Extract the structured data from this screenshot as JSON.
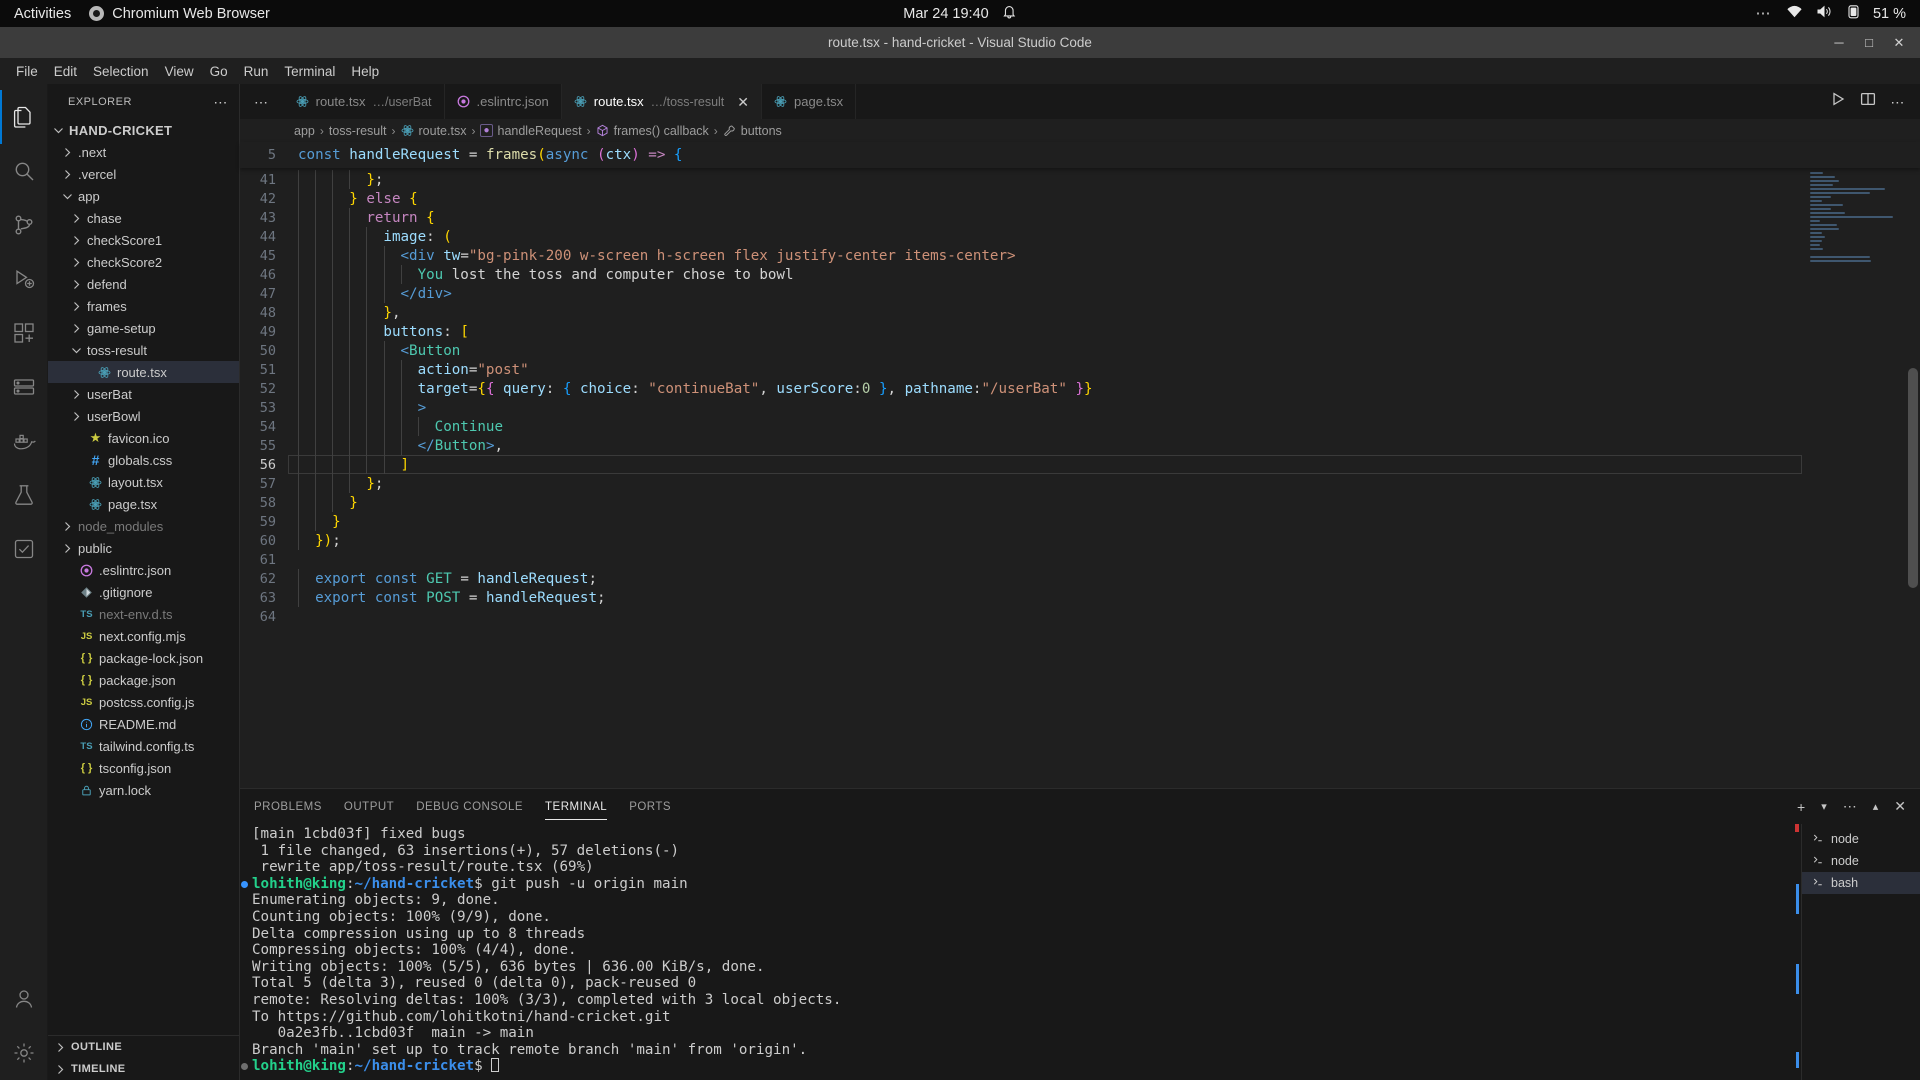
{
  "desktop": {
    "activities": "Activities",
    "active_app": "Chromium Web Browser",
    "app_icon": "chromium-icon",
    "clock": "Mar 24  19:40",
    "bell_icon": "notification-bell-icon",
    "tray_dots": "⋯",
    "wifi_icon": "wifi-icon",
    "volume_icon": "volume-icon",
    "battery_icon": "battery-icon",
    "battery_pct": "51 %"
  },
  "window": {
    "title": "route.tsx - hand-cricket - Visual Studio Code",
    "minimize": "─",
    "maximize": "□",
    "close": "✕"
  },
  "menubar": [
    "File",
    "Edit",
    "Selection",
    "View",
    "Go",
    "Run",
    "Terminal",
    "Help"
  ],
  "activitybar": [
    {
      "name": "explorer",
      "icon": "files-icon",
      "active": true
    },
    {
      "name": "search",
      "icon": "search-icon",
      "active": false
    },
    {
      "name": "source-control",
      "icon": "source-control-icon",
      "active": false
    },
    {
      "name": "run-debug",
      "icon": "run-debug-icon",
      "active": false
    },
    {
      "name": "extensions",
      "icon": "extensions-icon",
      "active": false
    },
    {
      "name": "remote-explorer",
      "icon": "remote-explorer-icon",
      "active": false
    },
    {
      "name": "docker",
      "icon": "docker-icon",
      "active": false
    },
    {
      "name": "testing",
      "icon": "beaker-icon",
      "active": false
    },
    {
      "name": "todo",
      "icon": "checklist-icon",
      "active": false
    }
  ],
  "activitybar_bottom": [
    {
      "name": "accounts",
      "icon": "account-icon"
    },
    {
      "name": "settings",
      "icon": "gear-icon"
    }
  ],
  "sidebar": {
    "header": "EXPLORER",
    "more_actions": "⋯",
    "tree": [
      {
        "label": "HAND-CRICKET",
        "depth": 0,
        "chev": "down",
        "kind": "root"
      },
      {
        "label": ".next",
        "depth": 1,
        "chev": "right",
        "kind": "folder"
      },
      {
        "label": ".vercel",
        "depth": 1,
        "chev": "right",
        "kind": "folder"
      },
      {
        "label": "app",
        "depth": 1,
        "chev": "down",
        "kind": "folder"
      },
      {
        "label": "chase",
        "depth": 2,
        "chev": "right",
        "kind": "folder"
      },
      {
        "label": "checkScore1",
        "depth": 2,
        "chev": "right",
        "kind": "folder"
      },
      {
        "label": "checkScore2",
        "depth": 2,
        "chev": "right",
        "kind": "folder"
      },
      {
        "label": "defend",
        "depth": 2,
        "chev": "right",
        "kind": "folder"
      },
      {
        "label": "frames",
        "depth": 2,
        "chev": "right",
        "kind": "folder"
      },
      {
        "label": "game-setup",
        "depth": 2,
        "chev": "right",
        "kind": "folder"
      },
      {
        "label": "toss-result",
        "depth": 2,
        "chev": "down",
        "kind": "folder"
      },
      {
        "label": "route.tsx",
        "depth": 3,
        "chev": "none",
        "kind": "react",
        "selected": true
      },
      {
        "label": "userBat",
        "depth": 2,
        "chev": "right",
        "kind": "folder"
      },
      {
        "label": "userBowl",
        "depth": 2,
        "chev": "right",
        "kind": "folder"
      },
      {
        "label": "favicon.ico",
        "depth": 2,
        "chev": "none",
        "kind": "favicon"
      },
      {
        "label": "globals.css",
        "depth": 2,
        "chev": "none",
        "kind": "css"
      },
      {
        "label": "layout.tsx",
        "depth": 2,
        "chev": "none",
        "kind": "react"
      },
      {
        "label": "page.tsx",
        "depth": 2,
        "chev": "none",
        "kind": "react"
      },
      {
        "label": "node_modules",
        "depth": 1,
        "chev": "right",
        "kind": "folder",
        "dim": true
      },
      {
        "label": "public",
        "depth": 1,
        "chev": "right",
        "kind": "folder"
      },
      {
        "label": ".eslintrc.json",
        "depth": 1,
        "chev": "none",
        "kind": "eslint"
      },
      {
        "label": ".gitignore",
        "depth": 1,
        "chev": "none",
        "kind": "git"
      },
      {
        "label": "next-env.d.ts",
        "depth": 1,
        "chev": "none",
        "kind": "ts",
        "dim": true
      },
      {
        "label": "next.config.mjs",
        "depth": 1,
        "chev": "none",
        "kind": "js"
      },
      {
        "label": "package-lock.json",
        "depth": 1,
        "chev": "none",
        "kind": "json"
      },
      {
        "label": "package.json",
        "depth": 1,
        "chev": "none",
        "kind": "json"
      },
      {
        "label": "postcss.config.js",
        "depth": 1,
        "chev": "none",
        "kind": "js"
      },
      {
        "label": "README.md",
        "depth": 1,
        "chev": "none",
        "kind": "md"
      },
      {
        "label": "tailwind.config.ts",
        "depth": 1,
        "chev": "none",
        "kind": "ts"
      },
      {
        "label": "tsconfig.json",
        "depth": 1,
        "chev": "none",
        "kind": "json"
      },
      {
        "label": "yarn.lock",
        "depth": 1,
        "chev": "none",
        "kind": "lock"
      }
    ],
    "sections": [
      {
        "label": "OUTLINE",
        "chev": "right"
      },
      {
        "label": "TIMELINE",
        "chev": "right"
      }
    ]
  },
  "tabs": [
    {
      "name": "route.tsx",
      "path": "…/userBat",
      "icon": "react-icon",
      "active": false,
      "closable": false
    },
    {
      "name": ".eslintrc.json",
      "path": "",
      "icon": "eslint-icon",
      "active": false,
      "closable": false
    },
    {
      "name": "route.tsx",
      "path": "…/toss-result",
      "icon": "react-icon",
      "active": true,
      "closable": true,
      "close": "✕"
    },
    {
      "name": "page.tsx",
      "path": "",
      "icon": "react-icon",
      "active": false,
      "closable": false
    }
  ],
  "tabbar_overflow": "⋯",
  "editor_actions": [
    {
      "name": "run-code-button",
      "icon": "play-icon",
      "glyph": "▷"
    },
    {
      "name": "split-editor-button",
      "icon": "split-editor-icon",
      "glyph": "◫"
    },
    {
      "name": "more-actions-button",
      "icon": "ellipsis-icon",
      "glyph": "⋯"
    }
  ],
  "breadcrumb": [
    {
      "label": "app",
      "icon": ""
    },
    {
      "label": "toss-result",
      "icon": ""
    },
    {
      "label": "route.tsx",
      "icon": "react-icon"
    },
    {
      "label": "handleRequest",
      "icon": "method-icon"
    },
    {
      "label": "frames() callback",
      "icon": "object-icon"
    },
    {
      "label": "buttons",
      "icon": "property-icon"
    }
  ],
  "breadcrumb_separator": "›",
  "sticky_line": {
    "number": "5",
    "text": "const handleRequest = frames(async (ctx) => {"
  },
  "code": {
    "first_line": 41,
    "current_line": 56,
    "lines": [
      {
        "n": 41,
        "indent": 4,
        "text": "};"
      },
      {
        "n": 42,
        "indent": 3,
        "text": "} else {"
      },
      {
        "n": 43,
        "indent": 4,
        "text": "return {"
      },
      {
        "n": 44,
        "indent": 5,
        "text": "image: ("
      },
      {
        "n": 45,
        "indent": 6,
        "text": "<div tw=\"bg-pink-200 w-screen h-screen flex justify-center items-center>"
      },
      {
        "n": 46,
        "indent": 7,
        "text": "You lost the toss and computer chose to bowl"
      },
      {
        "n": 47,
        "indent": 6,
        "text": "</div>"
      },
      {
        "n": 48,
        "indent": 5,
        "text": "},"
      },
      {
        "n": 49,
        "indent": 5,
        "text": "buttons: ["
      },
      {
        "n": 50,
        "indent": 6,
        "text": "<Button"
      },
      {
        "n": 51,
        "indent": 7,
        "text": "action=\"post\""
      },
      {
        "n": 52,
        "indent": 7,
        "text": "target={{ query: { choice: \"continueBat\", userScore:0 }, pathname:\"/userBat\" }}"
      },
      {
        "n": 53,
        "indent": 7,
        "text": ">"
      },
      {
        "n": 54,
        "indent": 8,
        "text": "Continue"
      },
      {
        "n": 55,
        "indent": 7,
        "text": "</Button>,"
      },
      {
        "n": 56,
        "indent": 6,
        "text": "]"
      },
      {
        "n": 57,
        "indent": 4,
        "text": "};"
      },
      {
        "n": 58,
        "indent": 3,
        "text": "}"
      },
      {
        "n": 59,
        "indent": 2,
        "text": "}"
      },
      {
        "n": 60,
        "indent": 1,
        "text": "});"
      },
      {
        "n": 61,
        "indent": 0,
        "text": ""
      },
      {
        "n": 62,
        "indent": 1,
        "text": "export const GET = handleRequest;"
      },
      {
        "n": 63,
        "indent": 1,
        "text": "export const POST = handleRequest;"
      },
      {
        "n": 64,
        "indent": 0,
        "text": ""
      }
    ]
  },
  "panel": {
    "tabs": [
      "PROBLEMS",
      "OUTPUT",
      "DEBUG CONSOLE",
      "TERMINAL",
      "PORTS"
    ],
    "active_tab": "TERMINAL",
    "actions": [
      {
        "name": "new-terminal-button",
        "icon": "plus-icon",
        "glyph": "+"
      },
      {
        "name": "terminal-split-dropdown",
        "icon": "chevron-down-icon",
        "glyph": "⌄"
      },
      {
        "name": "terminal-more-actions",
        "icon": "ellipsis-icon",
        "glyph": "⋯"
      },
      {
        "name": "maximize-panel-button",
        "icon": "chevron-up-icon",
        "glyph": "⌃"
      },
      {
        "name": "close-panel-button",
        "icon": "close-icon",
        "glyph": "✕"
      }
    ],
    "terminal_lines": [
      {
        "text": "[main 1cbd03f] fixed bugs"
      },
      {
        "text": " 1 file changed, 63 insertions(+), 57 deletions(-)"
      },
      {
        "text": " rewrite app/toss-result/route.tsx (69%)"
      },
      {
        "prompt": true,
        "user": "lohith@king",
        "colon": ":",
        "cwd": "~/hand-cricket",
        "dollar": "$ ",
        "cmd": "git push -u origin main"
      },
      {
        "text": "Enumerating objects: 9, done."
      },
      {
        "text": "Counting objects: 100% (9/9), done."
      },
      {
        "text": "Delta compression using up to 8 threads"
      },
      {
        "text": "Compressing objects: 100% (4/4), done."
      },
      {
        "text": "Writing objects: 100% (5/5), 636 bytes | 636.00 KiB/s, done."
      },
      {
        "text": "Total 5 (delta 3), reused 0 (delta 0), pack-reused 0"
      },
      {
        "text": "remote: Resolving deltas: 100% (3/3), completed with 3 local objects."
      },
      {
        "text": "To https://github.com/lohitkotni/hand-cricket.git"
      },
      {
        "text": "   0a2e3fb..1cbd03f  main -> main"
      },
      {
        "text": "Branch 'main' set up to track remote branch 'main' from 'origin'."
      },
      {
        "prompt": true,
        "grey": true,
        "user": "lohith@king",
        "colon": ":",
        "cwd": "~/hand-cricket",
        "dollar": "$ ",
        "cmd": "",
        "cursor": true
      }
    ],
    "terminal_list": [
      {
        "label": "node",
        "icon": "terminal-icon",
        "active": false
      },
      {
        "label": "node",
        "icon": "terminal-icon",
        "active": false
      },
      {
        "label": "bash",
        "icon": "terminal-icon",
        "active": true
      }
    ]
  },
  "colors": {
    "accent": "#0078d4",
    "bg_editor": "#1f1f1f",
    "bg_sidebar": "#181818",
    "bg_titlebar": "#3c3c3c",
    "terminal_green": "#23d18b",
    "terminal_blue": "#3b8eea",
    "selected_row": "#2b2f3a"
  }
}
